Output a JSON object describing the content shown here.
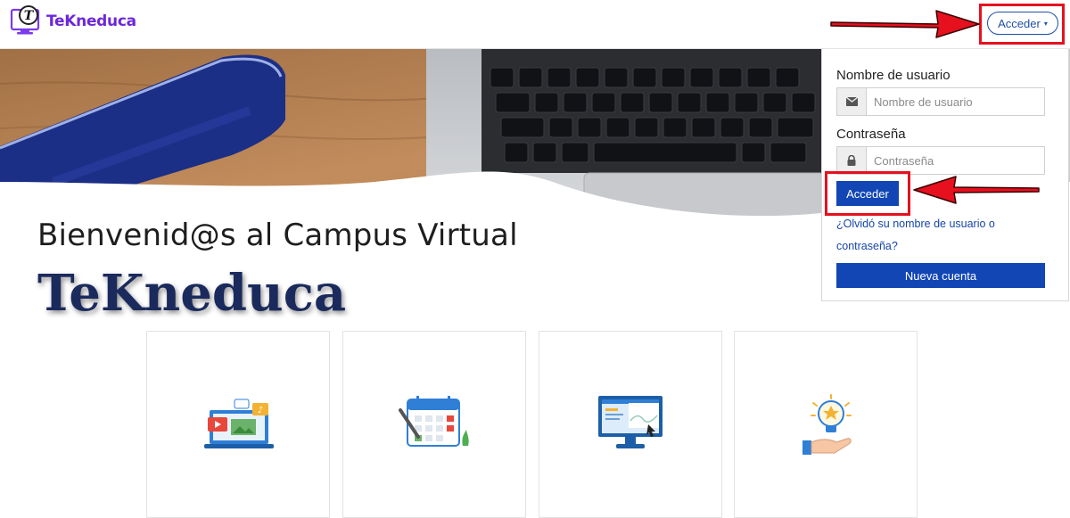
{
  "navbar": {
    "brand_name": "TeKneduca",
    "logo_letter": "T",
    "login_button_label": "Acceder",
    "login_button_caret": "▾"
  },
  "hero": {
    "welcome": "Bienvenid@s al Campus Virtual",
    "brand_title": "TeKneduca"
  },
  "login": {
    "username_label": "Nombre de usuario",
    "username_placeholder": "Nombre de usuario",
    "username_icon": "envelope-icon",
    "password_label": "Contraseña",
    "password_placeholder": "Contraseña",
    "password_icon": "lock-icon",
    "submit_label": "Acceder",
    "forgot_link": "¿Olvidó su nombre de usuario o contraseña?",
    "new_account_label": "Nueva cuenta"
  },
  "cards": [
    {
      "icon": "multimedia-laptop-icon"
    },
    {
      "icon": "calendar-icon"
    },
    {
      "icon": "computer-monitor-icon"
    },
    {
      "icon": "idea-hand-icon"
    }
  ],
  "colors": {
    "brand_purple": "#6d28d9",
    "primary_blue": "#1246b5",
    "highlight_red": "#e6101f",
    "title_navy": "#1b2a5c"
  }
}
